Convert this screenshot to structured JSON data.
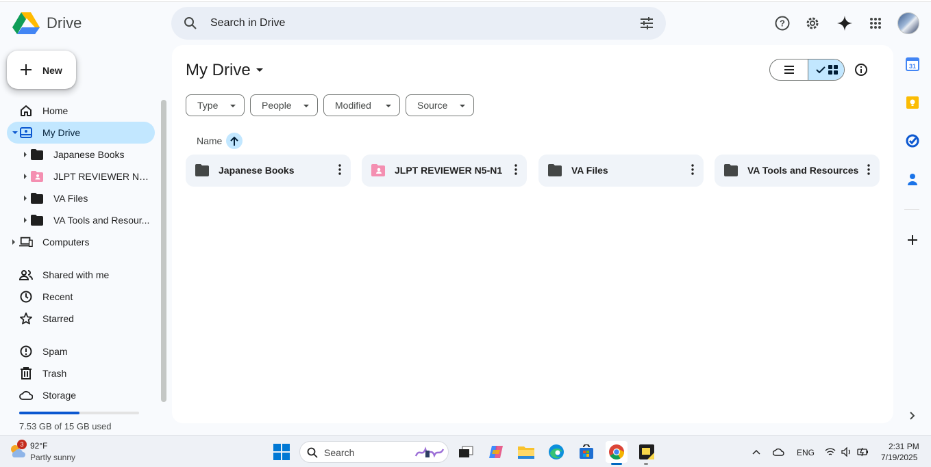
{
  "app": {
    "title": "Drive"
  },
  "search": {
    "placeholder": "Search in Drive"
  },
  "new_button": {
    "label": "New"
  },
  "sidebar": {
    "items": [
      {
        "label": "Home"
      },
      {
        "label": "My Drive"
      },
      {
        "label": "Japanese Books"
      },
      {
        "label": "JLPT REVIEWER N5-N1"
      },
      {
        "label": "VA Files"
      },
      {
        "label": "VA Tools and Resour..."
      },
      {
        "label": "Computers"
      },
      {
        "label": "Shared with me"
      },
      {
        "label": "Recent"
      },
      {
        "label": "Starred"
      },
      {
        "label": "Spam"
      },
      {
        "label": "Trash"
      },
      {
        "label": "Storage"
      }
    ],
    "storage": {
      "used_text": "7.53 GB of 15 GB used",
      "fraction": 0.502
    }
  },
  "main": {
    "title": "My Drive",
    "filters": [
      "Type",
      "People",
      "Modified",
      "Source"
    ],
    "sort_label": "Name",
    "folders": [
      {
        "name": "Japanese Books",
        "shared": false
      },
      {
        "name": "JLPT REVIEWER N5-N1",
        "shared": true
      },
      {
        "name": "VA Files",
        "shared": false
      },
      {
        "name": "VA Tools and Resources",
        "shared": false
      }
    ]
  },
  "right_panel": {
    "calendar_day": "31"
  },
  "taskbar": {
    "weather": {
      "temp": "92°F",
      "desc": "Partly sunny",
      "badge": "3"
    },
    "search_label": "Search",
    "lang": "ENG",
    "time": "2:31 PM",
    "date": "7/19/2025"
  },
  "colors": {
    "accent": "#0b57d0",
    "selected": "#c2e7ff",
    "folder": "#444746",
    "shared_folder": "#f48fb1"
  }
}
